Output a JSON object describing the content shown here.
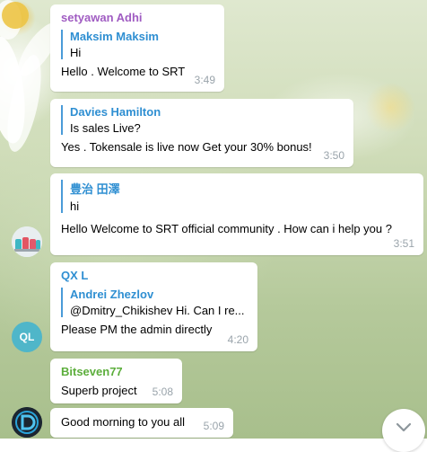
{
  "messages": [
    {
      "sender": "setyawan Adhi",
      "quote": {
        "name": "Maksim Maksim",
        "text": "Hi"
      },
      "text": "Hello . Welcome to SRT",
      "time": "3:49"
    },
    {
      "quote": {
        "name": "Davies Hamilton",
        "text": "Is sales Live?"
      },
      "text": "Yes . Tokensale is live now Get your 30% bonus!",
      "time": "3:50"
    },
    {
      "quote": {
        "name": "豊治 田澤",
        "text": "hi"
      },
      "text": "Hello Welcome to SRT official community . How can i help you ?",
      "time": "3:51"
    },
    {
      "sender": "QX L",
      "quote": {
        "name": "Andrei Zhezlov",
        "text": "@Dmitry_Chikishev Hi. Can I re..."
      },
      "text": "Please PM the admin directly",
      "time": "4:20"
    },
    {
      "sender": "Bitseven77",
      "text": "Superb project",
      "time": "5:08"
    },
    {
      "text": "Good morning to you all",
      "time": "5:09"
    }
  ],
  "avatars": {
    "ql_initials": "QL"
  },
  "icons": {
    "scroll_down": "chevron-down-icon"
  }
}
